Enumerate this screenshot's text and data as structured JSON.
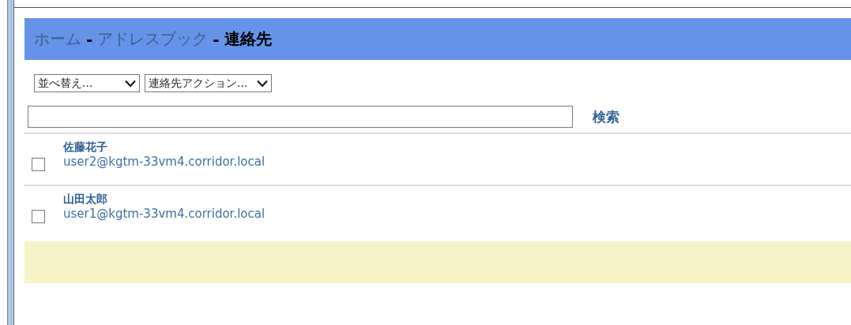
{
  "breadcrumb": [
    {
      "label": "ホーム",
      "kind": "link"
    },
    {
      "label": "アドレスブック",
      "kind": "link"
    },
    {
      "label": "連絡先",
      "kind": "current"
    }
  ],
  "separator": "-",
  "dropdowns": [
    {
      "value": "並べ替え..."
    },
    {
      "value": "連絡先アクション..."
    }
  ],
  "search": {
    "button": "検索"
  },
  "contacts": [
    {
      "name": "佐藤花子",
      "email": "user2@kgtm-33vm4.corridor.local",
      "checked": false
    },
    {
      "name": "山田太郎",
      "email": "user1@kgtm-33vm4.corridor.local",
      "checked": false
    }
  ]
}
